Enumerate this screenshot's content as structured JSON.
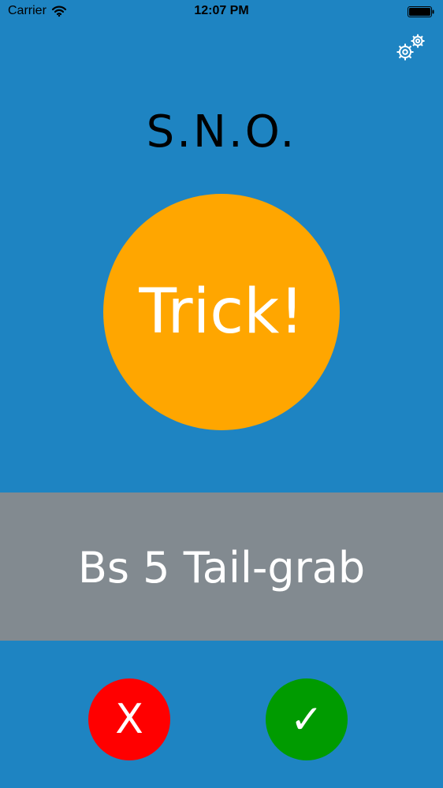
{
  "status_bar": {
    "carrier": "Carrier",
    "time": "12:07 PM",
    "wifi_icon": "wifi-icon",
    "battery_icon": "battery-icon"
  },
  "header": {
    "title": "S.N.O.",
    "settings_icon": "gears-icon"
  },
  "main": {
    "trick_button_label": "Trick!",
    "current_trick": "Bs 5 Tail-grab"
  },
  "actions": {
    "fail_label": "X",
    "success_label": "✓"
  },
  "colors": {
    "background": "#1e84c2",
    "trick_button": "#ffa600",
    "trick_band": "#828a90",
    "fail": "#ff0000",
    "success": "#009b00"
  }
}
